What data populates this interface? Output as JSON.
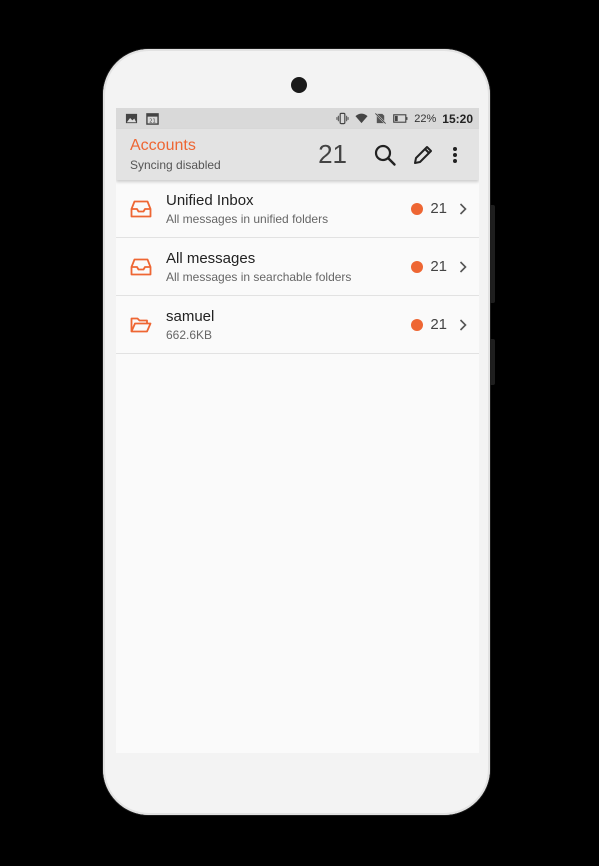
{
  "status_bar": {
    "battery": "22%",
    "time": "15:20"
  },
  "toolbar": {
    "title": "Accounts",
    "subtitle": "Syncing disabled",
    "unread_count": "21"
  },
  "accounts": [
    {
      "name": "Unified Inbox",
      "description": "All messages in unified folders",
      "count": "21",
      "icon": "inbox-icon"
    },
    {
      "name": "All messages",
      "description": "All messages in searchable folders",
      "count": "21",
      "icon": "inbox-icon"
    },
    {
      "name": "samuel",
      "description": "662.6KB",
      "count": "21",
      "icon": "folder-open-icon"
    }
  ],
  "colors": {
    "accent": "#ee6633",
    "toolbar_bg": "#e3e3e3",
    "status_bg": "#d9d9d9"
  }
}
